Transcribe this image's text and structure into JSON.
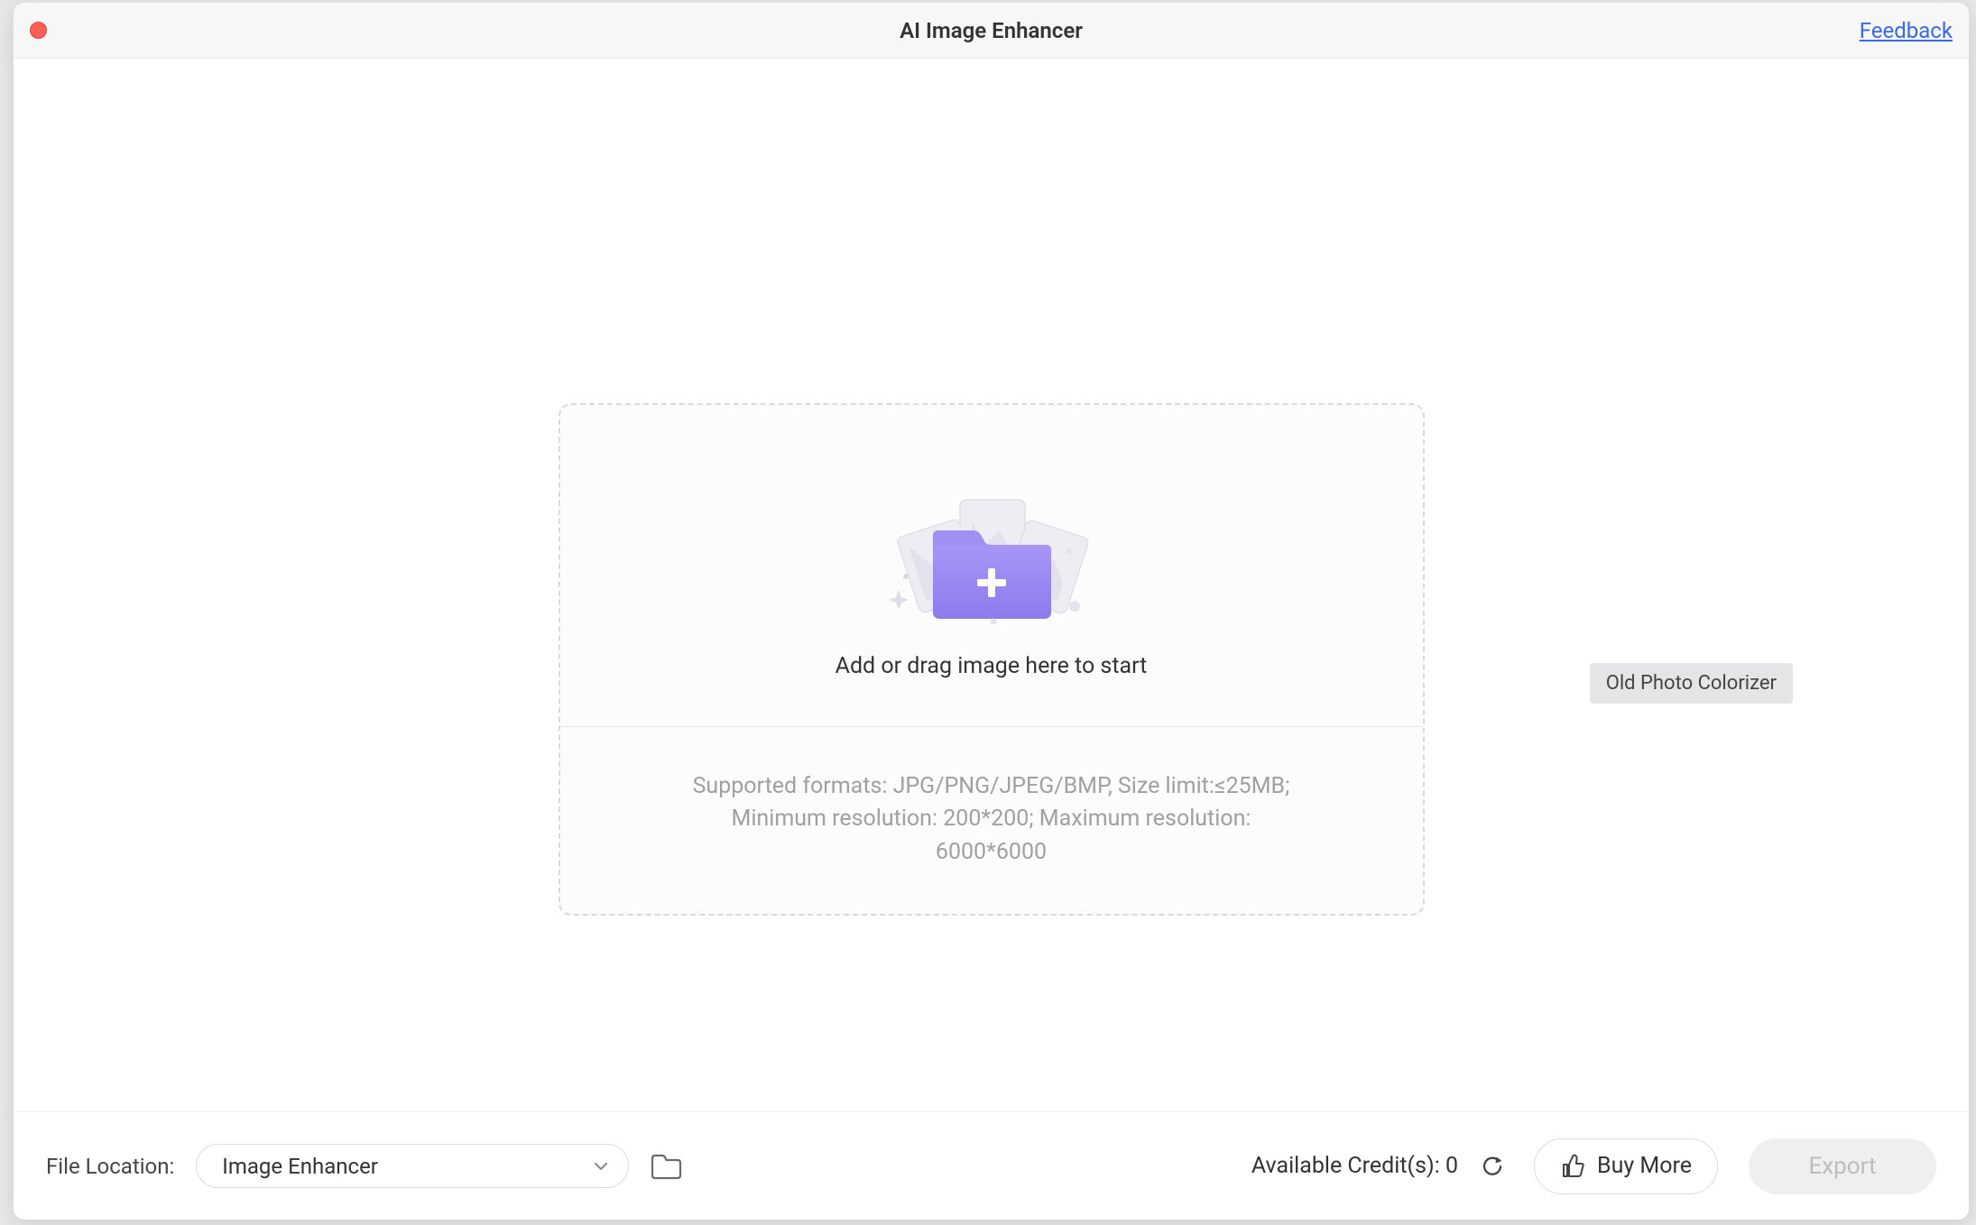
{
  "header": {
    "title": "AI Image Enhancer",
    "feedback_label": "Feedback"
  },
  "dropzone": {
    "instruction": "Add or drag image here to start",
    "formats_line1": "Supported formats: JPG/PNG/JPEG/BMP, Size limit:≤25MB;",
    "formats_line2": "Minimum resolution: 200*200; Maximum resolution:",
    "formats_line3": "6000*6000"
  },
  "tooltip": {
    "text": "Old Photo Colorizer"
  },
  "footer": {
    "file_location_label": "File Location:",
    "file_location_value": "Image Enhancer",
    "credits_label": "Available Credit(s): ",
    "credits_value": "0",
    "buy_more_label": "Buy More",
    "export_label": "Export"
  },
  "colors": {
    "accent": "#8d7bee",
    "link": "#3a67f0"
  }
}
